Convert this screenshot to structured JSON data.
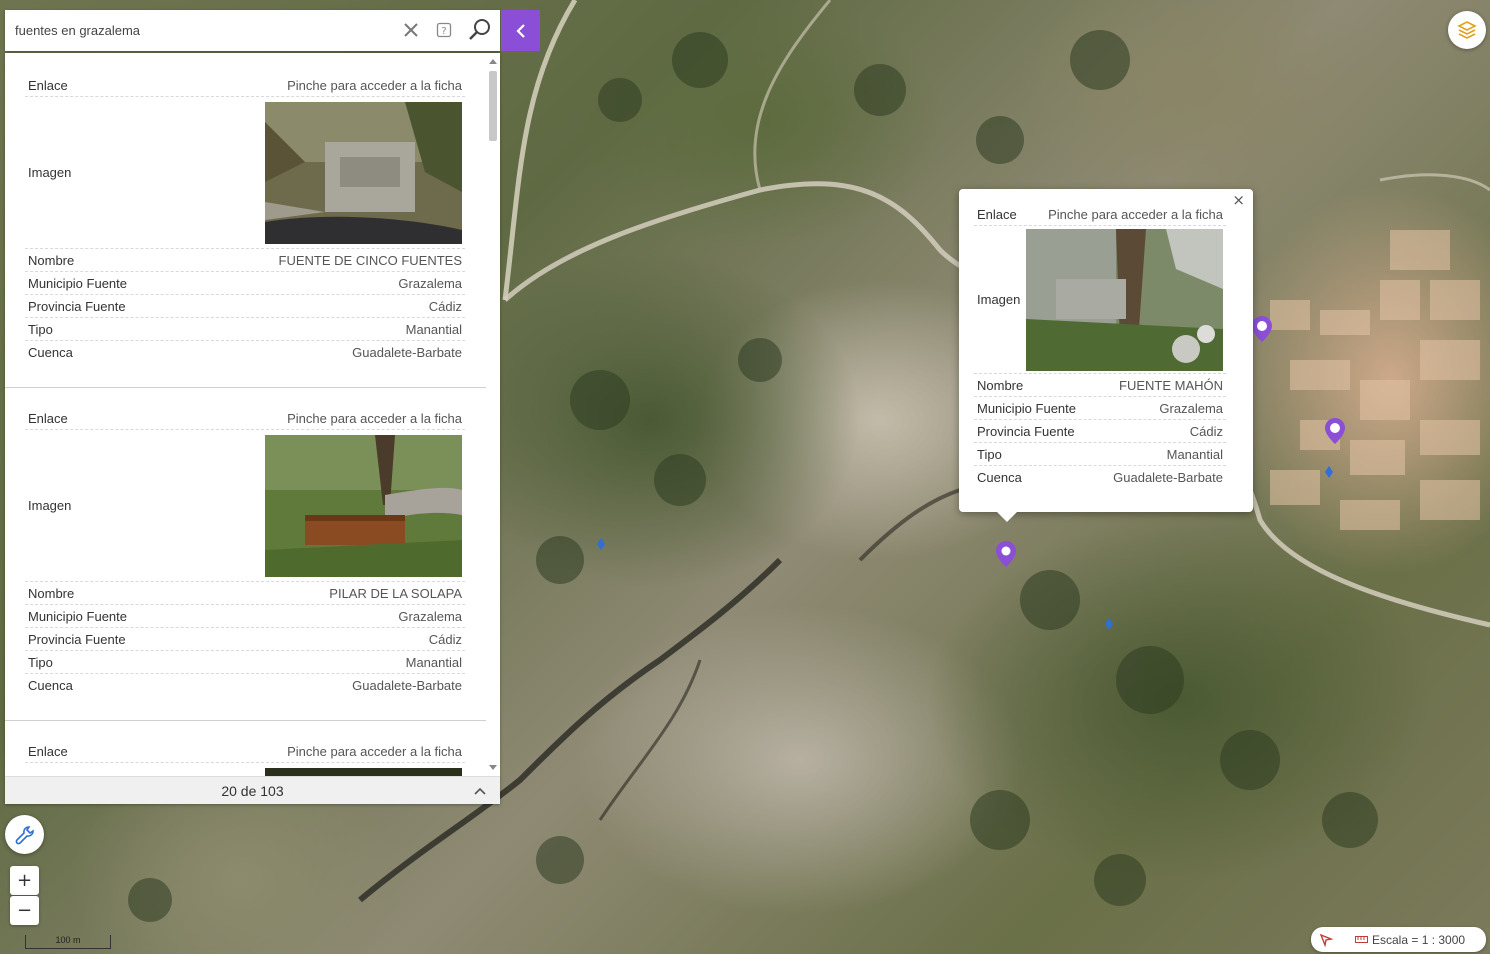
{
  "search": {
    "value": "fuentes en grazalema",
    "icons": [
      "close-icon",
      "help-icon",
      "search-icon"
    ],
    "collapse_icon": "chevron-left-icon"
  },
  "results": {
    "items": [
      {
        "enlace_label": "Enlace",
        "enlace_value": "Pinche para acceder a la ficha",
        "imagen_label": "Imagen",
        "nombre_label": "Nombre",
        "nombre_value": "FUENTE DE CINCO FUENTES",
        "municipio_label": "Municipio Fuente",
        "municipio_value": "Grazalema",
        "provincia_label": "Provincia Fuente",
        "provincia_value": "Cádiz",
        "tipo_label": "Tipo",
        "tipo_value": "Manantial",
        "cuenca_label": "Cuenca",
        "cuenca_value": "Guadalete-Barbate"
      },
      {
        "enlace_label": "Enlace",
        "enlace_value": "Pinche para acceder a la ficha",
        "imagen_label": "Imagen",
        "nombre_label": "Nombre",
        "nombre_value": "PILAR DE LA SOLAPA",
        "municipio_label": "Municipio Fuente",
        "municipio_value": "Grazalema",
        "provincia_label": "Provincia Fuente",
        "provincia_value": "Cádiz",
        "tipo_label": "Tipo",
        "tipo_value": "Manantial",
        "cuenca_label": "Cuenca",
        "cuenca_value": "Guadalete-Barbate"
      },
      {
        "enlace_label": "Enlace",
        "enlace_value": "Pinche para acceder a la ficha"
      }
    ],
    "pagination": "20 de 103"
  },
  "popup": {
    "enlace_label": "Enlace",
    "enlace_value": "Pinche para acceder a la ficha",
    "imagen_label": "Imagen",
    "nombre_label": "Nombre",
    "nombre_value": "FUENTE MAHÓN",
    "municipio_label": "Municipio Fuente",
    "municipio_value": "Grazalema",
    "provincia_label": "Provincia Fuente",
    "provincia_value": "Cádiz",
    "tipo_label": "Tipo",
    "tipo_value": "Manantial",
    "cuenca_label": "Cuenca",
    "cuenca_value": "Guadalete-Barbate",
    "close_glyph": "×"
  },
  "map_controls": {
    "zoom_in": "+",
    "zoom_out": "−",
    "scale_bar_label": "100 m",
    "scale_text": "Escala = 1 : 3000"
  },
  "colors": {
    "accent": "#8a4fd6",
    "marker": "#8a4fd6",
    "point": "#2f6fd6"
  }
}
